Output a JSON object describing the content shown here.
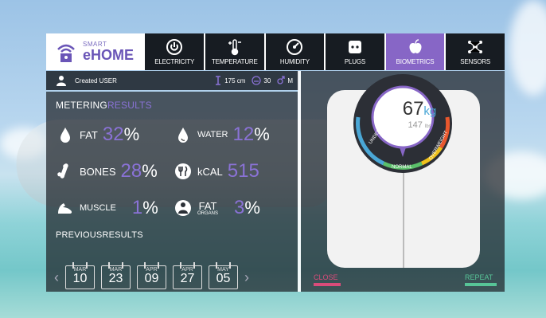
{
  "brand": {
    "small": "SMART",
    "name": "eHOME"
  },
  "tabs": [
    {
      "label": "ELECTRICITY",
      "icon": "power-icon"
    },
    {
      "label": "TEMPERATURE",
      "icon": "thermometer-icon"
    },
    {
      "label": "HUMIDITY",
      "icon": "gauge-icon"
    },
    {
      "label": "PLUGS",
      "icon": "plug-icon"
    },
    {
      "label": "BIOMETRICS",
      "icon": "apple-icon"
    },
    {
      "label": "SENSORS",
      "icon": "network-icon"
    }
  ],
  "user": {
    "name": "Created USER",
    "height": "175 cm",
    "age": "30",
    "gender": "M"
  },
  "metering": {
    "title_main": "METERING",
    "title_accent": "RESULTS",
    "fat": {
      "label": "FAT",
      "value": "32",
      "unit": "%"
    },
    "water": {
      "label": "WATER",
      "value": "12",
      "unit": "%"
    },
    "bones": {
      "label": "BONES",
      "value": "28",
      "unit": "%"
    },
    "kcal": {
      "label": "kCAL",
      "value": "515"
    },
    "muscle": {
      "label": "MUSCLE",
      "value": "1",
      "unit": "%"
    },
    "fat_organs": {
      "label": "FAT",
      "sublabel": "ORGANS",
      "value": "3",
      "unit": "%"
    }
  },
  "previous": {
    "title": "PREVIOUSRESULTS",
    "dates": [
      {
        "month": "MAR",
        "day": "10"
      },
      {
        "month": "MAR",
        "day": "23"
      },
      {
        "month": "APR",
        "day": "09"
      },
      {
        "month": "APR",
        "day": "27"
      },
      {
        "month": "MAY",
        "day": "05"
      }
    ]
  },
  "scale": {
    "kg": "67",
    "kg_unit": "kg",
    "lbs": "147",
    "lbs_unit": "lbs",
    "labels": {
      "under": "UNDERWEIGHT",
      "normal": "NORMAL",
      "over": "OVERWEIGHT"
    }
  },
  "actions": {
    "close": "CLOSE",
    "repeat": "REPEAT"
  },
  "colors": {
    "accent": "#8766c6",
    "close": "#d94c7a",
    "repeat": "#57c497"
  }
}
